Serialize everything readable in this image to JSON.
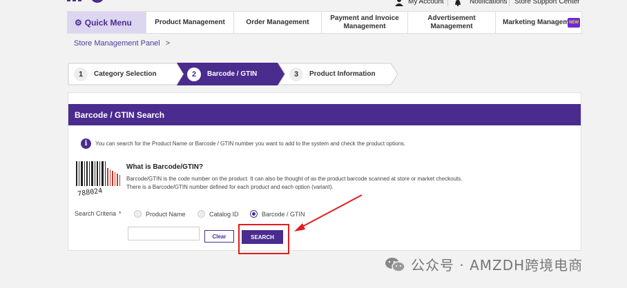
{
  "header": {
    "my_account": "My Account",
    "notifications": "Notifications",
    "support": "Store Support Center"
  },
  "nav": {
    "quick_menu": "Quick Menu",
    "items": [
      "Product Management",
      "Order Management",
      "Payment and Invoice Management",
      "Advertisement Management",
      "Marketing Managemen"
    ],
    "new_badge": "NEW"
  },
  "breadcrumb": {
    "label": "Store Management Panel",
    "arrow": ">"
  },
  "steps": [
    {
      "num": "1",
      "label": "Category Selection",
      "active": false
    },
    {
      "num": "2",
      "label": "Barcode / GTIN",
      "active": true
    },
    {
      "num": "3",
      "label": "Product Information",
      "active": false
    }
  ],
  "panel": {
    "title": "Barcode / GTIN Search",
    "info": "You can search for the Product Name or Barcode / GTIN number you want to add to the system and check the product options.",
    "info_icon": "i",
    "what_title": "What is Barcode/GTIN?",
    "what_desc_1": "Barcode/GTIN is the code number on the product. It can also be thought of as the product barcode scanned at store or market checkouts.",
    "what_desc_2": "There is a Barcode/GTIN number defined for each product and each option (variant).",
    "barcode_digits": "788024"
  },
  "search": {
    "criteria_label": "Search Criteria",
    "required_mark": "*",
    "options": [
      "Product Name",
      "Catalog ID",
      "Barcode / GTIN"
    ],
    "selected": "Barcode / GTIN",
    "input_value": "",
    "clear_label": "Clear",
    "search_label": "SEARCH"
  },
  "watermark": {
    "text": "公众号 · AMZDH跨境电商"
  },
  "colors": {
    "brand": "#4a2b8e",
    "annotation": "#e21c1c",
    "quick_menu_bg": "#ddd6f1"
  },
  "icons": [
    "gear-icon",
    "user-icon",
    "bell-icon",
    "info-icon",
    "barcode-image",
    "wechat-icon"
  ]
}
